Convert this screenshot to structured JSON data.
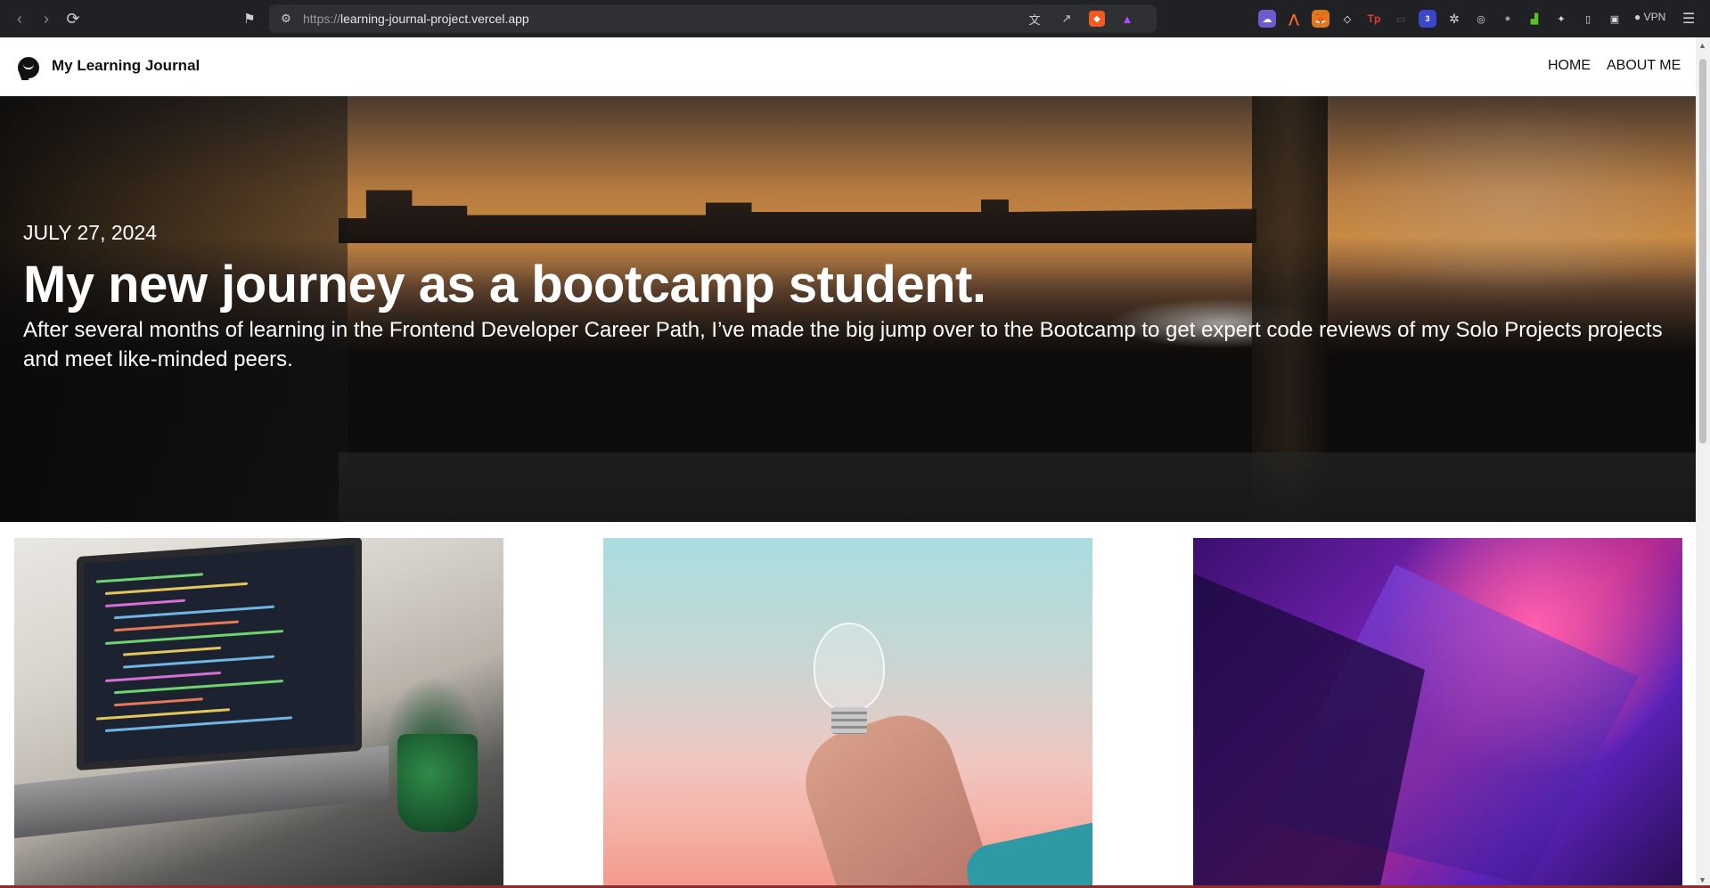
{
  "browser": {
    "url_scheme": "https://",
    "url_host": "learning-journal-project.vercel.app",
    "vpn_label": "VPN",
    "extension_badge": "3"
  },
  "site": {
    "title": "My Learning Journal",
    "nav": [
      {
        "label": "HOME"
      },
      {
        "label": "ABOUT ME"
      }
    ]
  },
  "hero": {
    "date": "JULY 27, 2024",
    "title": "My new journey as a bootcamp student.",
    "description": "After several months of learning in the Frontend Developer Career Path, I’ve made the big jump over to the Bootcamp to get expert code reviews of my Solo Projects projects and meet like-minded peers."
  },
  "cards": [
    {
      "image": "laptop-with-code-and-plant"
    },
    {
      "image": "hand-holding-lightbulb"
    },
    {
      "image": "purple-pink-abstract"
    }
  ]
}
